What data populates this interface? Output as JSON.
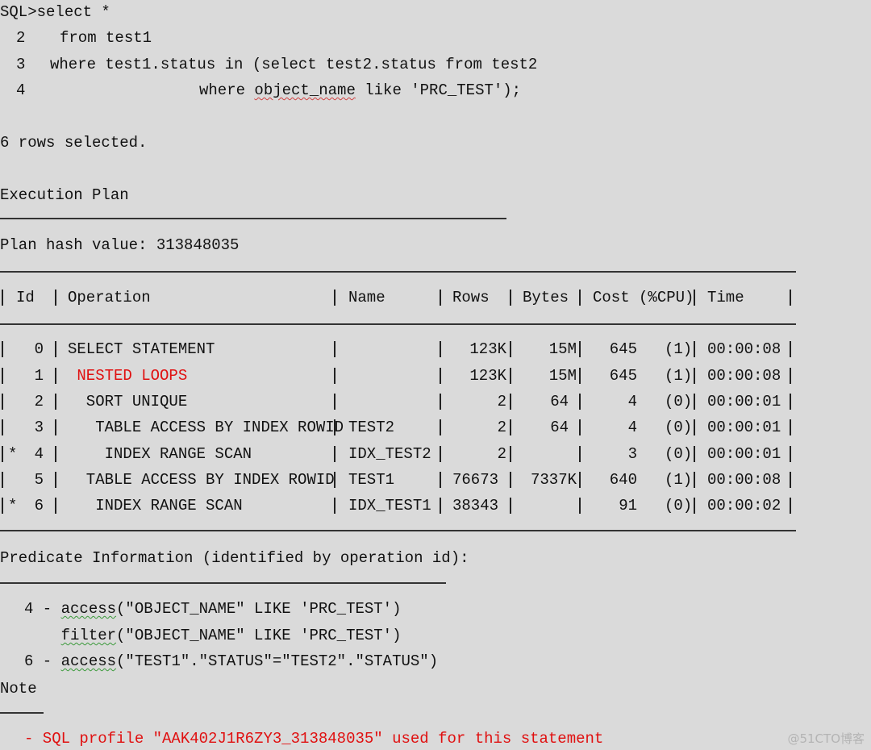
{
  "query": {
    "line1": "SQL>select *",
    "line2_num": "2",
    "line2": "from test1",
    "line3_num": "3",
    "line3": "where test1.status in (select test2.status from test2",
    "line4_num": "4",
    "line4_pre": "where ",
    "line4_flag": "object_name",
    "line4_post": " like 'PRC_TEST');"
  },
  "result": "6 rows selected.",
  "plan": {
    "title": "Execution Plan",
    "hash": "Plan hash value: 313848035",
    "headers": [
      "Id",
      "Operation",
      "Name",
      "Rows",
      "Bytes",
      "Cost (%CPU)",
      "Time"
    ],
    "rows": [
      {
        "mark": "",
        "id": "0",
        "op": "SELECT STATEMENT",
        "name": "",
        "rows": "123K",
        "bytes": "15M",
        "cost": "645",
        "cpu": "(1)",
        "time": "00:00:08"
      },
      {
        "mark": "",
        "id": "1",
        "op": " NESTED LOOPS",
        "name": "",
        "rows": "123K",
        "bytes": "15M",
        "cost": "645",
        "cpu": "(1)",
        "time": "00:00:08",
        "highlight": true
      },
      {
        "mark": "",
        "id": "2",
        "op": "  SORT UNIQUE",
        "name": "",
        "rows": "2",
        "bytes": "64",
        "cost": "4",
        "cpu": "(0)",
        "time": "00:00:01"
      },
      {
        "mark": "",
        "id": "3",
        "op": "   TABLE ACCESS BY INDEX ROWID",
        "name": "TEST2",
        "rows": "2",
        "bytes": "64",
        "cost": "4",
        "cpu": "(0)",
        "time": "00:00:01"
      },
      {
        "mark": "*",
        "id": "4",
        "op": "    INDEX RANGE SCAN",
        "name": "IDX_TEST2",
        "rows": "2",
        "bytes": "",
        "cost": "3",
        "cpu": "(0)",
        "time": "00:00:01"
      },
      {
        "mark": "",
        "id": "5",
        "op": "  TABLE ACCESS BY INDEX ROWID",
        "name": "TEST1",
        "rows": "76673",
        "bytes": "7337K",
        "cost": "640",
        "cpu": "(1)",
        "time": "00:00:08"
      },
      {
        "mark": "*",
        "id": "6",
        "op": "   INDEX RANGE SCAN",
        "name": "IDX_TEST1",
        "rows": "38343",
        "bytes": "",
        "cost": "91",
        "cpu": "(0)",
        "time": "00:00:02"
      }
    ]
  },
  "predicates": {
    "title": "Predicate Information (identified by operation id):",
    "items": [
      {
        "id": "4 - ",
        "fn": "access",
        "expr": "(\"OBJECT_NAME\" LIKE 'PRC_TEST')"
      },
      {
        "id": "    ",
        "fn": "filter",
        "expr": "(\"OBJECT_NAME\" LIKE 'PRC_TEST')"
      },
      {
        "id": "6 - ",
        "fn": "access",
        "expr": "(\"TEST1\".\"STATUS\"=\"TEST2\".\"STATUS\")"
      }
    ]
  },
  "note": {
    "title": "Note",
    "text": "- SQL profile \"AAK402J1R6ZY3_313848035\" used for this statement"
  },
  "watermark": "@51CTO博客",
  "colors": {
    "background": "#dadada",
    "highlight": "#e01010"
  }
}
